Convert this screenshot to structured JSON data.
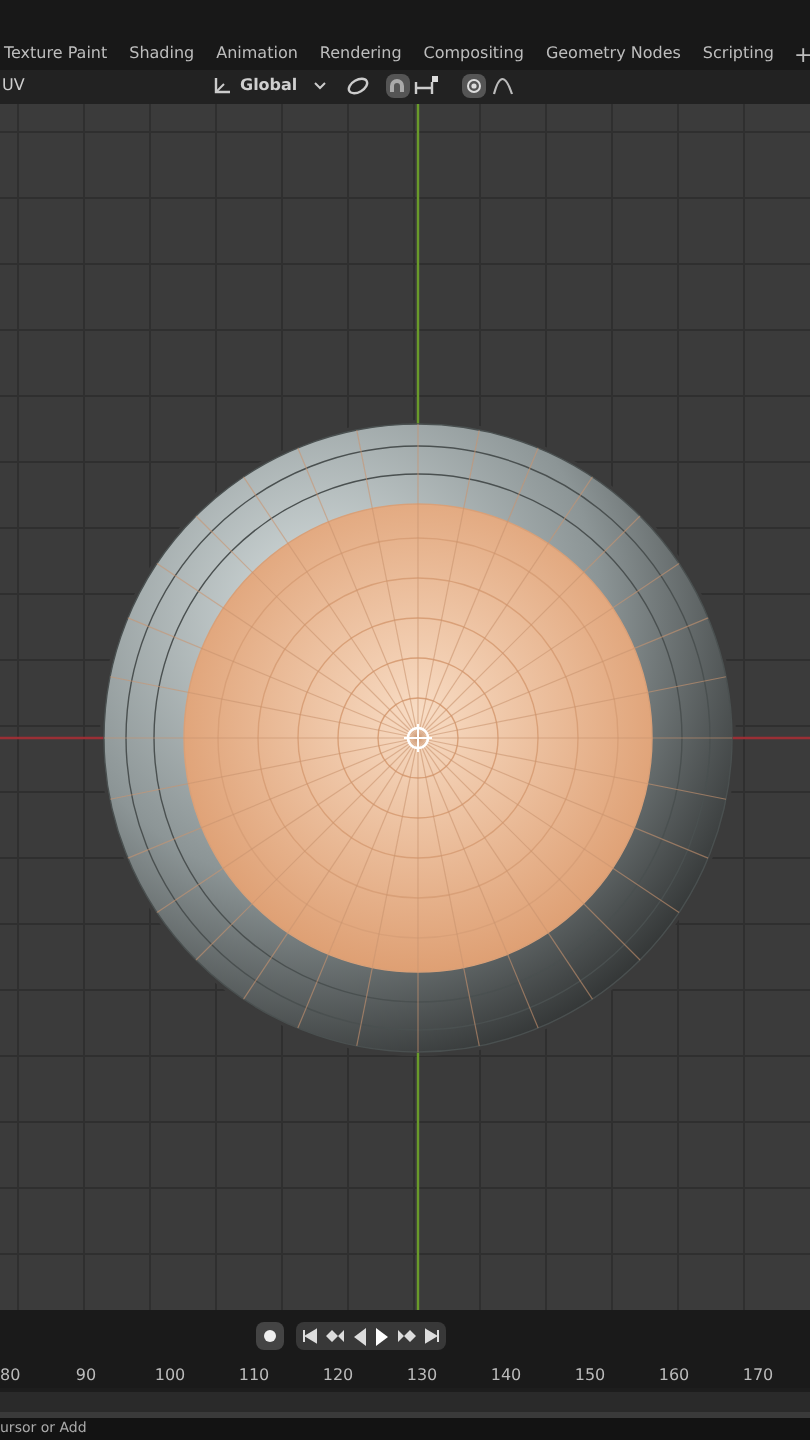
{
  "workspace_tabs": [
    {
      "label": "Texture Paint",
      "selected": false
    },
    {
      "label": "Shading",
      "selected": false
    },
    {
      "label": "Animation",
      "selected": false
    },
    {
      "label": "Rendering",
      "selected": false
    },
    {
      "label": "Compositing",
      "selected": false
    },
    {
      "label": "Geometry Nodes",
      "selected": false
    },
    {
      "label": "Scripting",
      "selected": false
    }
  ],
  "add_tab": "+",
  "header": {
    "menu": "UV",
    "orientation": "Global",
    "snap_on": true,
    "proportional_on": true
  },
  "timeline": {
    "record_on": false,
    "frames": [
      "80",
      "90",
      "100",
      "110",
      "120",
      "130",
      "140",
      "150",
      "160",
      "170"
    ]
  },
  "status_bar": "ursor or Add"
}
